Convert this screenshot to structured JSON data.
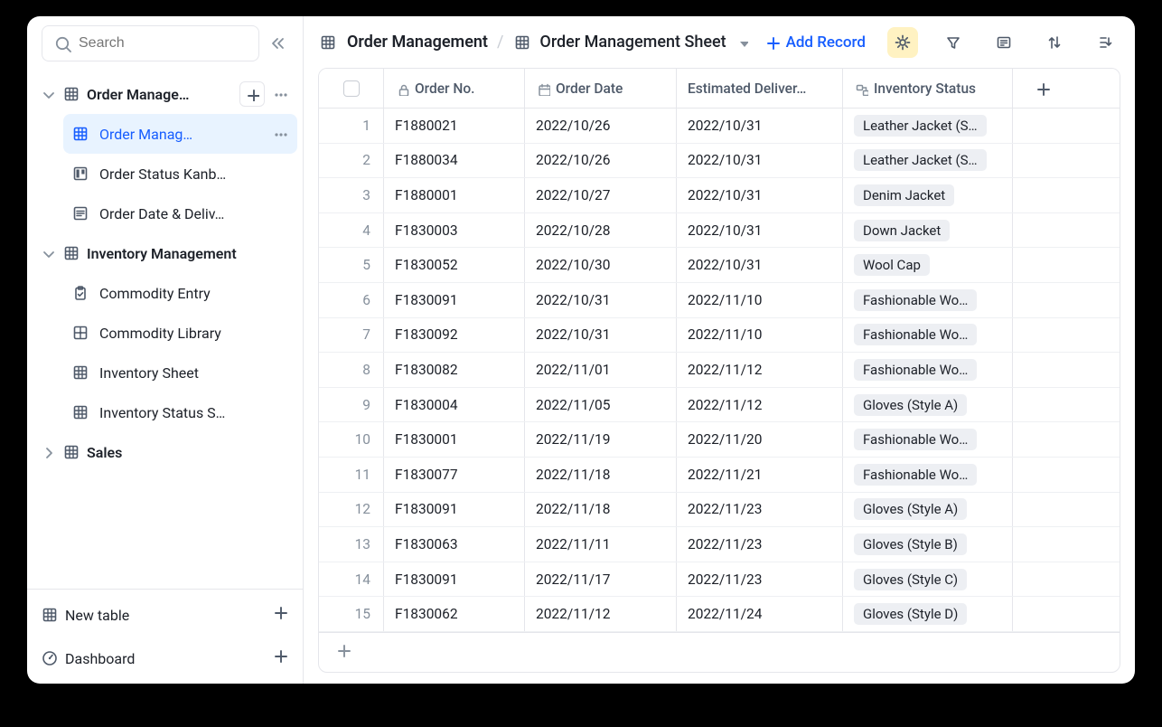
{
  "search": {
    "placeholder": "Search"
  },
  "sidebar": {
    "sections": [
      {
        "label": "Order Manage…",
        "expanded": true,
        "children": [
          {
            "label": "Order Manag…",
            "icon": "grid",
            "active": true,
            "more": true
          },
          {
            "label": "Order Status Kanb…",
            "icon": "kanban"
          },
          {
            "label": "Order Date & Deliv…",
            "icon": "form"
          }
        ]
      },
      {
        "label": "Inventory Management",
        "expanded": true,
        "children": [
          {
            "label": "Commodity Entry",
            "icon": "clipboard"
          },
          {
            "label": "Commodity Library",
            "icon": "library"
          },
          {
            "label": "Inventory Sheet",
            "icon": "grid"
          },
          {
            "label": "Inventory Status S…",
            "icon": "grid"
          }
        ]
      },
      {
        "label": "Sales",
        "expanded": false,
        "children": []
      }
    ],
    "bottom": [
      {
        "label": "New table",
        "icon": "grid",
        "plus": true
      },
      {
        "label": "Dashboard",
        "icon": "gauge",
        "plus": true
      }
    ]
  },
  "breadcrumb": {
    "table": "Order Management",
    "sheet": "Order Management Sheet"
  },
  "actions": {
    "add_record": "Add Record"
  },
  "columns": {
    "order_no": "Order No.",
    "order_date": "Order Date",
    "delivery": "Estimated Deliver…",
    "inventory": "Inventory Status"
  },
  "rows": [
    {
      "idx": "1",
      "order": "F1880021",
      "date": "2022/10/26",
      "delivery": "2022/10/31",
      "inv": "Leather Jacket (S…"
    },
    {
      "idx": "2",
      "order": "F1880034",
      "date": "2022/10/26",
      "delivery": "2022/10/31",
      "inv": "Leather Jacket (S…"
    },
    {
      "idx": "3",
      "order": "F1880001",
      "date": "2022/10/27",
      "delivery": "2022/10/31",
      "inv": "Denim Jacket"
    },
    {
      "idx": "4",
      "order": "F1830003",
      "date": "2022/10/28",
      "delivery": "2022/10/31",
      "inv": "Down Jacket"
    },
    {
      "idx": "5",
      "order": "F1830052",
      "date": "2022/10/30",
      "delivery": "2022/10/31",
      "inv": "Wool Cap"
    },
    {
      "idx": "6",
      "order": "F1830091",
      "date": "2022/10/31",
      "delivery": "2022/11/10",
      "inv": "Fashionable Wo…"
    },
    {
      "idx": "7",
      "order": "F1830092",
      "date": "2022/10/31",
      "delivery": "2022/11/10",
      "inv": "Fashionable Wo…"
    },
    {
      "idx": "8",
      "order": "F1830082",
      "date": "2022/11/01",
      "delivery": "2022/11/12",
      "inv": "Fashionable Wo…"
    },
    {
      "idx": "9",
      "order": "F1830004",
      "date": "2022/11/05",
      "delivery": "2022/11/12",
      "inv": "Gloves (Style A)"
    },
    {
      "idx": "10",
      "order": "F1830001",
      "date": "2022/11/19",
      "delivery": "2022/11/20",
      "inv": "Fashionable Wo…"
    },
    {
      "idx": "11",
      "order": "F1830077",
      "date": "2022/11/18",
      "delivery": "2022/11/21",
      "inv": "Fashionable Wo…"
    },
    {
      "idx": "12",
      "order": "F1830091",
      "date": "2022/11/18",
      "delivery": "2022/11/23",
      "inv": "Gloves (Style A)"
    },
    {
      "idx": "13",
      "order": "F1830063",
      "date": "2022/11/11",
      "delivery": "2022/11/23",
      "inv": "Gloves (Style B)"
    },
    {
      "idx": "14",
      "order": "F1830091",
      "date": "2022/11/17",
      "delivery": "2022/11/23",
      "inv": "Gloves (Style C)"
    },
    {
      "idx": "15",
      "order": "F1830062",
      "date": "2022/11/12",
      "delivery": "2022/11/24",
      "inv": "Gloves (Style D)"
    }
  ]
}
